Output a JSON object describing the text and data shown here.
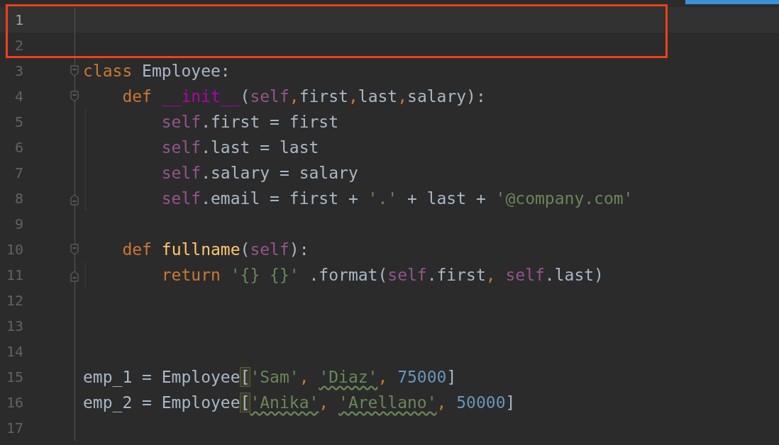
{
  "lines": [
    {
      "number": "1",
      "current": true
    },
    {
      "number": "2",
      "current": false
    },
    {
      "number": "3",
      "current": false,
      "fold_start": true,
      "tokens": [
        {
          "text": "class",
          "kind": "keyword"
        },
        {
          "text": " Employee:",
          "kind": "plain"
        }
      ]
    },
    {
      "number": "4",
      "current": false,
      "fold_start": true,
      "tokens": [
        {
          "text": "    def",
          "kind": "keyword"
        },
        {
          "text": " __init__",
          "kind": "magic"
        },
        {
          "text": "(",
          "kind": "plain"
        },
        {
          "text": "self",
          "kind": "self"
        },
        {
          "text": ",",
          "kind": "comma"
        },
        {
          "text": "first",
          "kind": "plain"
        },
        {
          "text": ",",
          "kind": "comma"
        },
        {
          "text": "last",
          "kind": "plain"
        },
        {
          "text": ",",
          "kind": "comma"
        },
        {
          "text": "salary):",
          "kind": "plain"
        }
      ]
    },
    {
      "number": "5",
      "current": false,
      "tokens": [
        {
          "text": "        self",
          "kind": "self"
        },
        {
          "text": ".first = first",
          "kind": "plain"
        }
      ]
    },
    {
      "number": "6",
      "current": false,
      "tokens": [
        {
          "text": "        self",
          "kind": "self"
        },
        {
          "text": ".last = last",
          "kind": "plain"
        }
      ]
    },
    {
      "number": "7",
      "current": false,
      "tokens": [
        {
          "text": "        self",
          "kind": "self"
        },
        {
          "text": ".salary = salary",
          "kind": "plain"
        }
      ]
    },
    {
      "number": "8",
      "current": false,
      "fold_end": true,
      "tokens": [
        {
          "text": "        self",
          "kind": "self"
        },
        {
          "text": ".email = first + ",
          "kind": "plain"
        },
        {
          "text": "'.'",
          "kind": "string"
        },
        {
          "text": " + last + ",
          "kind": "plain"
        },
        {
          "text": "'@company.com'",
          "kind": "string"
        }
      ]
    },
    {
      "number": "9",
      "current": false
    },
    {
      "number": "10",
      "current": false,
      "fold_start": true,
      "tokens": [
        {
          "text": "    def",
          "kind": "keyword"
        },
        {
          "text": " fullname",
          "kind": "func"
        },
        {
          "text": "(",
          "kind": "plain"
        },
        {
          "text": "self",
          "kind": "self"
        },
        {
          "text": "):",
          "kind": "plain"
        }
      ]
    },
    {
      "number": "11",
      "current": false,
      "fold_end": true,
      "tokens": [
        {
          "text": "        return",
          "kind": "keyword"
        },
        {
          "text": " '{} {}'",
          "kind": "string"
        },
        {
          "text": " .format(",
          "kind": "plain"
        },
        {
          "text": "self",
          "kind": "self"
        },
        {
          "text": ".first",
          "kind": "plain"
        },
        {
          "text": ", ",
          "kind": "comma"
        },
        {
          "text": "self",
          "kind": "self"
        },
        {
          "text": ".last)",
          "kind": "plain"
        }
      ]
    },
    {
      "number": "12",
      "current": false
    },
    {
      "number": "13",
      "current": false
    },
    {
      "number": "14",
      "current": false
    },
    {
      "number": "15",
      "current": false,
      "tokens": [
        {
          "text": "emp_1 = Employee",
          "kind": "plain"
        },
        {
          "text": "[",
          "kind": "plain",
          "matched": true
        },
        {
          "text": "'Sam'",
          "kind": "string",
          "warning": false
        },
        {
          "text": ", ",
          "kind": "comma"
        },
        {
          "text": "'Diaz'",
          "kind": "string",
          "warning": true
        },
        {
          "text": ", ",
          "kind": "comma"
        },
        {
          "text": "75000",
          "kind": "number"
        },
        {
          "text": "]",
          "kind": "plain"
        }
      ]
    },
    {
      "number": "16",
      "current": false,
      "tokens": [
        {
          "text": "emp_2 = Employee",
          "kind": "plain"
        },
        {
          "text": "[",
          "kind": "plain",
          "matched": true
        },
        {
          "text": "'Anika'",
          "kind": "string",
          "warning": true
        },
        {
          "text": ", ",
          "kind": "comma"
        },
        {
          "text": "'Arellano'",
          "kind": "string",
          "warning": true
        },
        {
          "text": ", ",
          "kind": "comma"
        },
        {
          "text": "50000",
          "kind": "number"
        },
        {
          "text": "]",
          "kind": "plain"
        }
      ]
    },
    {
      "number": "17",
      "current": false
    }
  ],
  "highlight_box": {
    "shown": true
  },
  "tab_indicator": {
    "shown": true
  }
}
